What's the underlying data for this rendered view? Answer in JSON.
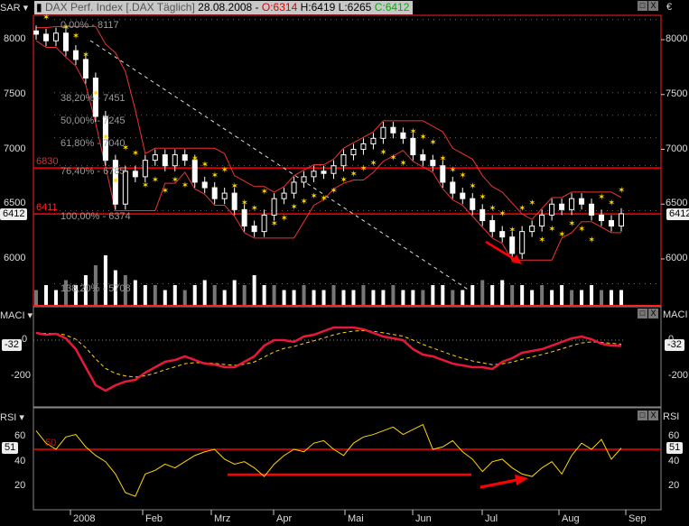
{
  "header": {
    "indicator": "SAR",
    "title": "DAX Perf. Index [.DAX  Täglich]",
    "date": "28.08.2008 -",
    "open": "O:6314",
    "high": "H:6419",
    "low": "L:6265",
    "close": "C:6412",
    "currency": "€"
  },
  "panels": {
    "macd_label": "MACI",
    "rsi_label": "RSI"
  },
  "colors": {
    "accent_red": "#ff0000",
    "sar": "#ffd700",
    "macd": "#e8183c",
    "rsi": "#ffd700",
    "frame": "#ff2020"
  },
  "chart_data": [
    {
      "type": "candlestick",
      "title": "DAX Perf. Index",
      "ylim": [
        5650,
        8300
      ],
      "yticks": [
        6000,
        6500,
        7000,
        7500,
        8000
      ],
      "xticks": [
        "2008",
        "Feb",
        "Mrz",
        "Apr",
        "Mai",
        "Jun",
        "Jul",
        "Aug",
        "Sep"
      ],
      "closes": [
        8050,
        7990,
        8060,
        7900,
        7820,
        7650,
        7300,
        6900,
        6500,
        6800,
        6750,
        6900,
        6950,
        6850,
        6950,
        6900,
        6700,
        6650,
        6550,
        6600,
        6450,
        6300,
        6250,
        6400,
        6550,
        6600,
        6700,
        6750,
        6800,
        6780,
        6850,
        6950,
        7000,
        7050,
        7100,
        7200,
        7150,
        7100,
        6950,
        6900,
        6850,
        6700,
        6600,
        6550,
        6450,
        6350,
        6250,
        6200,
        6050,
        6250,
        6300,
        6400,
        6500,
        6450,
        6550,
        6500,
        6400,
        6350,
        6300,
        6412
      ],
      "volumes": [
        3,
        4,
        3,
        5,
        4,
        6,
        8,
        10,
        7,
        6,
        5,
        4,
        4,
        3,
        4,
        3,
        4,
        5,
        4,
        3,
        5,
        4,
        6,
        4,
        4,
        3,
        3,
        4,
        3,
        3,
        4,
        3,
        3,
        4,
        3,
        3,
        4,
        3,
        3,
        3,
        4,
        4,
        3,
        3,
        4,
        5,
        4,
        5,
        4,
        4,
        3,
        4,
        3,
        4,
        3,
        3,
        4,
        3,
        3,
        3
      ],
      "horizontal_levels": [
        {
          "value": 6830,
          "label": "6830"
        },
        {
          "value": 6411,
          "label": "6411"
        }
      ],
      "last_value": "6412",
      "fibonacci": [
        {
          "value": 8117,
          "label": "0,00% - 8117"
        },
        {
          "value": 7451,
          "label": "38,20% - 7451"
        },
        {
          "value": 7245,
          "label": "50,00% - 7245"
        },
        {
          "value": 7040,
          "label": "61,80% - 7040"
        },
        {
          "value": 6785,
          "label": "76,40% - 6785"
        },
        {
          "value": 6374,
          "label": "100,00% - 6374"
        },
        {
          "value": 5708,
          "label": "138,20% - 5708"
        }
      ]
    },
    {
      "type": "line",
      "title": "MACI",
      "ylim": [
        -330,
        120
      ],
      "yticks": [
        0,
        -200
      ],
      "last_value": "-32",
      "values": [
        40,
        30,
        35,
        10,
        -50,
        -150,
        -250,
        -280,
        -250,
        -230,
        -220,
        -180,
        -150,
        -120,
        -110,
        -90,
        -110,
        -130,
        -135,
        -150,
        -150,
        -120,
        -90,
        -30,
        0,
        0,
        -10,
        20,
        30,
        50,
        70,
        70,
        70,
        60,
        40,
        20,
        10,
        0,
        -50,
        -80,
        -90,
        -110,
        -130,
        -140,
        -150,
        -150,
        -160,
        -120,
        -100,
        -70,
        -60,
        -50,
        -30,
        -10,
        10,
        20,
        5,
        -20,
        -30,
        -32
      ]
    },
    {
      "type": "line",
      "title": "RSI",
      "ylim": [
        0,
        80
      ],
      "yticks": [
        60,
        40,
        20
      ],
      "level": 50,
      "level_label": "50",
      "last_value": "51",
      "values": [
        65,
        55,
        50,
        60,
        62,
        52,
        45,
        40,
        30,
        15,
        12,
        30,
        33,
        38,
        35,
        40,
        45,
        48,
        50,
        42,
        38,
        40,
        35,
        28,
        38,
        45,
        50,
        48,
        55,
        57,
        50,
        45,
        55,
        60,
        62,
        65,
        68,
        62,
        66,
        70,
        50,
        52,
        57,
        48,
        42,
        32,
        40,
        42,
        35,
        30,
        28,
        35,
        40,
        30,
        45,
        55,
        50,
        58,
        42,
        51
      ]
    }
  ]
}
